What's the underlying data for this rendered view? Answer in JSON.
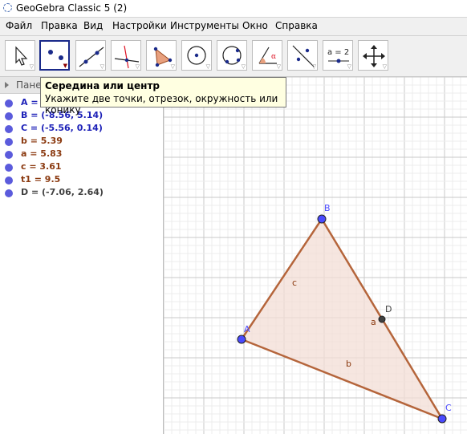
{
  "window": {
    "title": "GeoGebra Classic 5 (2)"
  },
  "menu": [
    "Файл",
    "Правка",
    "Вид",
    "Настройки",
    "Инструменты",
    "Окно",
    "Справка"
  ],
  "tools": [
    {
      "name": "move-tool-icon"
    },
    {
      "name": "point-tool-icon"
    },
    {
      "name": "line-tool-icon"
    },
    {
      "name": "perpendicular-line-tool-icon"
    },
    {
      "name": "polygon-tool-icon"
    },
    {
      "name": "circle-center-point-tool-icon"
    },
    {
      "name": "circle-three-points-tool-icon"
    },
    {
      "name": "angle-tool-icon"
    },
    {
      "name": "reflect-tool-icon"
    },
    {
      "name": "slider-tool-icon",
      "label": "a = 2"
    },
    {
      "name": "move-graphics-view-tool-icon"
    }
  ],
  "algebra": {
    "header": "Пане",
    "items": [
      {
        "text": "A = ",
        "color": "#1e22b8"
      },
      {
        "text": "B = (-8.56, 5.14)",
        "color": "#1e22b8"
      },
      {
        "text": "C = (-5.56, 0.14)",
        "color": "#1e22b8"
      },
      {
        "text": "b = 5.39",
        "color": "#8b3a10"
      },
      {
        "text": "a = 5.83",
        "color": "#8b3a10"
      },
      {
        "text": "c = 3.61",
        "color": "#8b3a10"
      },
      {
        "text": "t1 = 9.5",
        "color": "#8b3a10"
      },
      {
        "text": "D = (-7.06, 2.64)",
        "color": "#404040"
      }
    ]
  },
  "tooltip": {
    "title": "Середина или центр",
    "description": "Укажите две точки, отрезок, окружность или конику"
  },
  "graphics": {
    "points": [
      {
        "label": "A",
        "color": "#4a4aff"
      },
      {
        "label": "B",
        "color": "#4a4aff"
      },
      {
        "label": "C",
        "color": "#4a4aff"
      },
      {
        "label": "D",
        "color": "#404040"
      }
    ],
    "segments": [
      {
        "label": "a"
      },
      {
        "label": "b"
      },
      {
        "label": "c"
      }
    ],
    "polygon_fill": "#f3ddd6",
    "segment_color": "#b5653b"
  }
}
